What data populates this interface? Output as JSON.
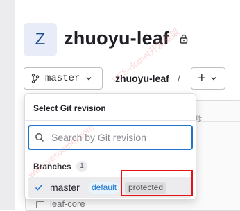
{
  "project": {
    "avatar_letter": "Z",
    "title": "zhuoyu-leaf"
  },
  "toolbar": {
    "branch_label": "master",
    "breadcrumb": "zhuoyu-leaf",
    "breadcrumb_separator": "/",
    "add_label": "+"
  },
  "dropdown": {
    "title": "Select Git revision",
    "search": {
      "placeholder": "Search by Git revision",
      "value": ""
    },
    "section": {
      "label": "Branches",
      "count": "1"
    },
    "items": [
      {
        "name": "master",
        "default_badge": "default",
        "protected_badge": "protected"
      }
    ]
  },
  "background": {
    "file_item": "leaf-core",
    "glyph": "除"
  },
  "watermark": {
    "line1": "VES-dotnet开发框架",
    "line2": "www.vesdotnet.com"
  },
  "colors": {
    "focus": "#1f75cb",
    "highlight": "#e41414",
    "selected_row": "#ececef"
  }
}
